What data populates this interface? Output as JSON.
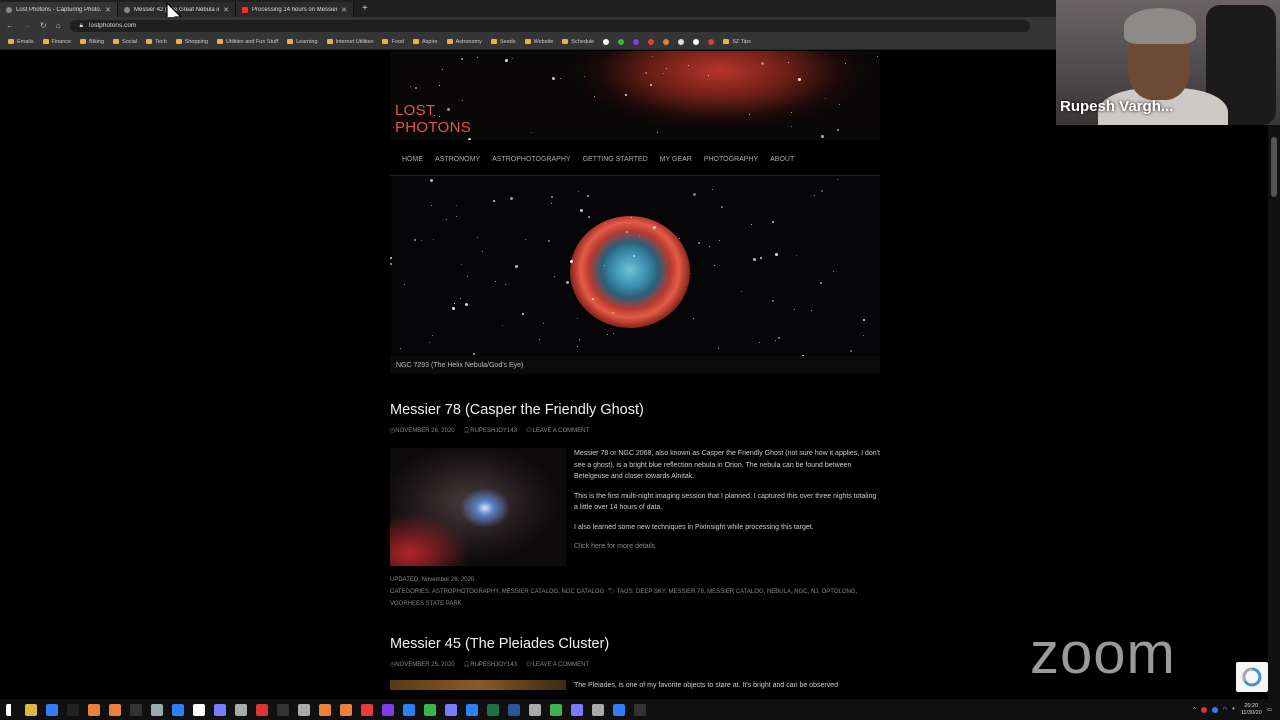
{
  "browser": {
    "tabs": [
      {
        "title": "Lost Photons - Capturing Photo...",
        "color": "#888888",
        "active": true
      },
      {
        "title": "Messier 42 (The Great Nebula in...",
        "color": "#888888",
        "active": false
      },
      {
        "title": "Processing 14 hours on Messier...",
        "color": "#ff2b2b",
        "active": false
      }
    ],
    "new_tab": "+",
    "url": "lostphotons.com",
    "bookmarks": [
      "Emails",
      "Finance",
      "Biking",
      "Social",
      "Tech",
      "Shopping",
      "Utilities and Fun Stuff",
      "Learning",
      "Internet Utilities",
      "Food",
      "Aspire",
      "Astronomy",
      "Seeds",
      "Website",
      "Schedule",
      "SZ Tips"
    ]
  },
  "site": {
    "logo_line1": "LOST",
    "logo_line2": "PHOTONS",
    "nav": [
      "HOME",
      "ASTRONOMY",
      "ASTROPHOTOGRAPHY",
      "GETTING STARTED",
      "MY GEAR",
      "PHOTOGRAPHY",
      "ABOUT"
    ],
    "hero_caption": "NGC 7293 (The Helix Nebula/God's Eye)",
    "post1": {
      "title": "Messier 78 (Casper the Friendly Ghost)",
      "date": "NOVEMBER 26, 2020",
      "author": "RUPESHJOY143",
      "comment": "LEAVE A COMMENT",
      "para1": "Messier 78 or NGC 2068, also known as Casper the Friendly Ghost (not sure how it applies, I don't see a ghost), is a bright blue reflection nebula in Orion. The nebula can be found between Betelgeuse and closer towards Alnitak.",
      "para2": "This is the first multi-night imaging session that I planned. I captured this over three nights totaling a little over 14 hours of data.",
      "para3": "I also learned some new techniques in PixInsight while processing this target.",
      "more": "Click here for more details",
      "updated": "UPDATED: November 26, 2020",
      "categories": "CATEGORIES: ASTROPHOTOGRAPHY, MESSIER CATALOG, NGC CATALOG",
      "tags": "TAGS: DEEP SKY, MESSIER 78, MESSIER CATALOG, NEBULA, NGC, NJ, OPTOLONG, VOORHEES STATE PARK"
    },
    "post2": {
      "title": "Messier 45 (The Pleiades Cluster)",
      "date": "NOVEMBER 25, 2020",
      "author": "RUPESHJOY143",
      "comment": "LEAVE A COMMENT",
      "para1": "The Pleiades, is one of my favorite objects to stare at. It's bright and can be observed"
    }
  },
  "webcam": {
    "name": "Rupesh Vargh..."
  },
  "zoom_logo": "zoom",
  "taskbar": {
    "time": "20:20",
    "date": "11/30/20"
  },
  "colors": {
    "accent": "#e0584a",
    "background": "#000000"
  }
}
